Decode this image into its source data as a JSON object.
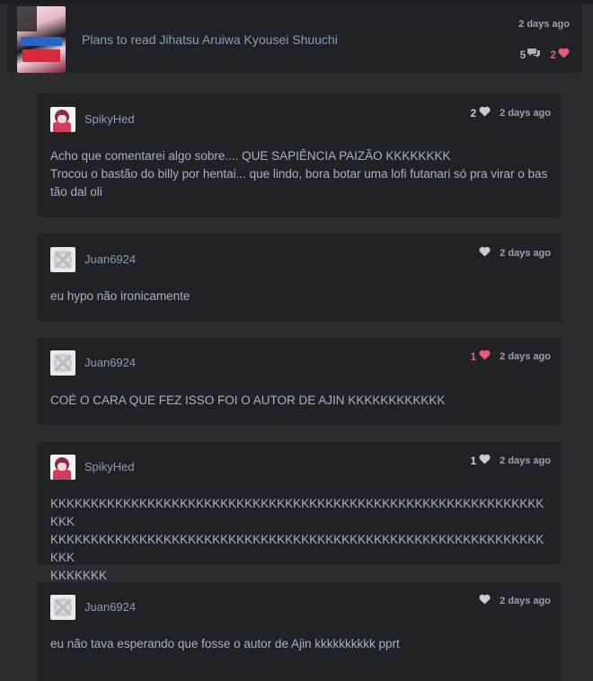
{
  "activity": {
    "cover_icon": "manga-cover-thumbnail",
    "text": "Plans to read Jihatsu Aruiwa Kyousei Shuuchi",
    "time": "2 days ago",
    "reply_count": "5",
    "like_count": "2"
  },
  "replies": [
    {
      "user": "SpikyHed",
      "likes": "2",
      "liked": false,
      "time": "2 days ago",
      "lines": [
        "Acho que comentarei algo sobre.... QUE SAPIÊNCIA PAIZÃO KKKKKKKK",
        "Trocou o bastão do billy por hentai... que lindo, bora botar uma lofi futanari só pra virar o bastão dal oli"
      ]
    },
    {
      "user": "Juan6924",
      "likes": "",
      "liked": false,
      "time": "2 days ago",
      "lines": [
        "eu hypo não ironicamente"
      ]
    },
    {
      "user": "Juan6924",
      "likes": "1",
      "liked": true,
      "time": "2 days ago",
      "lines": [
        "COÉ O CARA QUE FEZ ISSO FOI O AUTOR DE AJIN KKKKKKKKKKKK"
      ]
    },
    {
      "user": "SpikyHed",
      "likes": "1",
      "liked": false,
      "time": "2 days ago",
      "lines": [
        "KKKKKKKKKKKKKKKKKKKKKKKKKKKKKKKKKKKKKKKKKKKKKKKKKKKKKKKKKKKKKKKK",
        "KKKKKKKKKKKKKKKKKKKKKKKKKKKKKKKKKKKKKKKKKKKKKKKKKKKKKKKKKKKKKKKK",
        "KKKKKKK"
      ]
    },
    {
      "user": "Juan6924",
      "likes": "",
      "liked": false,
      "time": "2 days ago",
      "lines": [
        "eu não tava esperando que fosse o autor de Ajin kkkkkkkkkk pprt"
      ]
    }
  ],
  "colors": {
    "background": "#2b2d31",
    "card": "#212226",
    "link_text": "#8d9bb6",
    "body_text": "#a5b1c6",
    "like_active": "#e85d75"
  },
  "icons": {
    "reply": "speech-bubbles-icon",
    "like": "heart-icon"
  }
}
